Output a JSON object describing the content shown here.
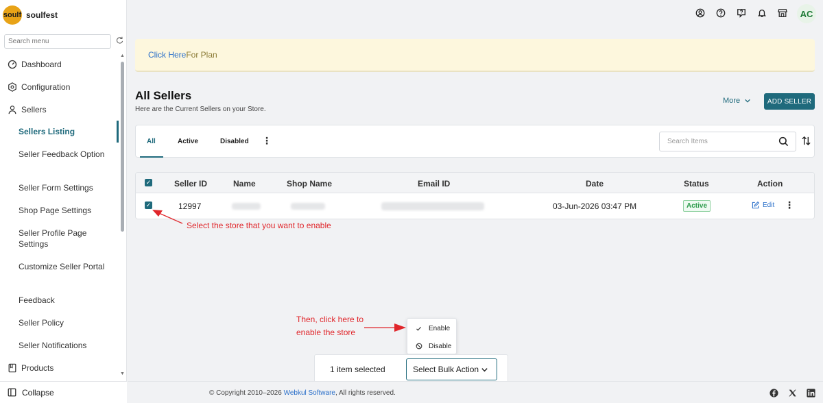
{
  "brand": {
    "logo_text": "soulf",
    "name": "soulfest"
  },
  "sidebar": {
    "search_placeholder": "Search menu",
    "items": [
      {
        "label": "Dashboard",
        "icon": "dashboard-icon"
      },
      {
        "label": "Configuration",
        "icon": "settings-hexagon-icon"
      },
      {
        "label": "Sellers",
        "icon": "user-icon"
      }
    ],
    "sub_items": [
      {
        "label": "Sellers Listing",
        "active": true
      },
      {
        "label": "Seller Feedback Option"
      },
      {
        "label": "Seller Form Settings"
      },
      {
        "label": "Shop Page Settings"
      },
      {
        "label": "Seller Profile Page Settings"
      },
      {
        "label": "Customize Seller Portal"
      },
      {
        "label": "Feedback"
      },
      {
        "label": "Seller Policy"
      },
      {
        "label": "Seller Notifications"
      }
    ],
    "products_label": "Products",
    "collapse_label": "Collapse"
  },
  "topbar": {
    "icons": [
      "user-circle-icon",
      "help-circle-icon",
      "help-chat-icon",
      "bell-icon",
      "store-icon"
    ],
    "avatar_initials": "AC"
  },
  "banner": {
    "link_text": "Click Here",
    "text": "For Plan"
  },
  "page": {
    "title": "All Sellers",
    "subtitle": "Here are the Current Sellers on your Store.",
    "more_label": "More",
    "add_button_label": "ADD SELLER"
  },
  "tabs": [
    {
      "label": "All",
      "active": true
    },
    {
      "label": "Active"
    },
    {
      "label": "Disabled"
    }
  ],
  "search": {
    "placeholder": "Search Items"
  },
  "table": {
    "columns": [
      "Seller ID",
      "Name",
      "Shop Name",
      "Email ID",
      "Date",
      "Status",
      "Action"
    ],
    "rows": [
      {
        "seller_id": "12997",
        "date": "03-Jun-2026 03:47 PM",
        "status": "Active",
        "action": "Edit"
      }
    ]
  },
  "annotations": {
    "select_store": "Select the store that you want to enable",
    "click_here_line1": "Then, click here to",
    "click_here_line2": "enable the store",
    "color": "#e0262b"
  },
  "bulk_menu": {
    "items": [
      "Enable",
      "Disable"
    ]
  },
  "bulk_bar": {
    "count_label": "1 item selected",
    "select_label": "Select Bulk Action"
  },
  "footer": {
    "copyright_prefix": "© Copyright 2010–2026 ",
    "company": "Webkul Software",
    "copyright_suffix": ", All rights reserved.",
    "social": [
      "facebook-icon",
      "x-icon",
      "linkedin-icon"
    ]
  },
  "colors": {
    "primary": "#1f6a7c",
    "link": "#2a6fc9",
    "banner_bg": "#fdf7dd",
    "status_green": "#2b9a4a"
  }
}
